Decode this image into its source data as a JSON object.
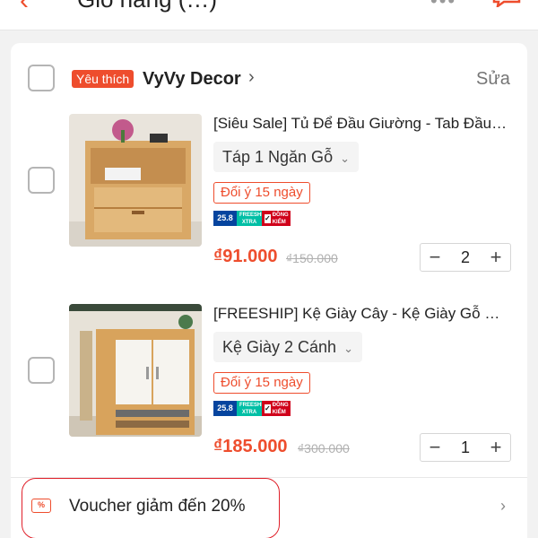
{
  "header": {
    "back_icon": "arrow-left-icon",
    "title": "Giỏ hàng (…)",
    "more_icon": "more-icon",
    "chat_icon": "chat-icon"
  },
  "shop": {
    "tag": "Yêu thích",
    "name": "VyVy Decor",
    "arrow": "›",
    "edit_label": "Sửa"
  },
  "items": [
    {
      "name": "[Siêu Sale] Tủ Để Đầu Giường - Tab Đầu Giường",
      "variant": "Táp 1 Ngăn Gỗ",
      "return_policy": "Đổi ý 15 ngày",
      "badge_date": "25.8",
      "badge_ship": "FREESHIP XTRA",
      "badge_check": "ĐỒNG KIỂM",
      "price": "₫91.000",
      "original_price": "₫150.000",
      "quantity": "2",
      "minus": "−",
      "plus": "+"
    },
    {
      "name": "[FREESHIP] Kệ Giày Cây - Kệ Giày Gỗ Cao Cấp",
      "variant": "Kệ Giày 2 Cánh",
      "return_policy": "Đổi ý 15 ngày",
      "badge_date": "25.8",
      "badge_ship": "FREESHIP XTRA",
      "badge_check": "ĐỒNG KIỂM",
      "price": "₫185.000",
      "original_price": "₫300.000",
      "quantity": "1",
      "minus": "−",
      "plus": "+"
    }
  ],
  "voucher": {
    "icon": "voucher-percent-icon",
    "icon_text": "%",
    "text": "Voucher giảm đến 20%",
    "chevron": "›"
  },
  "colors": {
    "accent": "#ee4d2d",
    "highlight_border": "#e0202a"
  }
}
